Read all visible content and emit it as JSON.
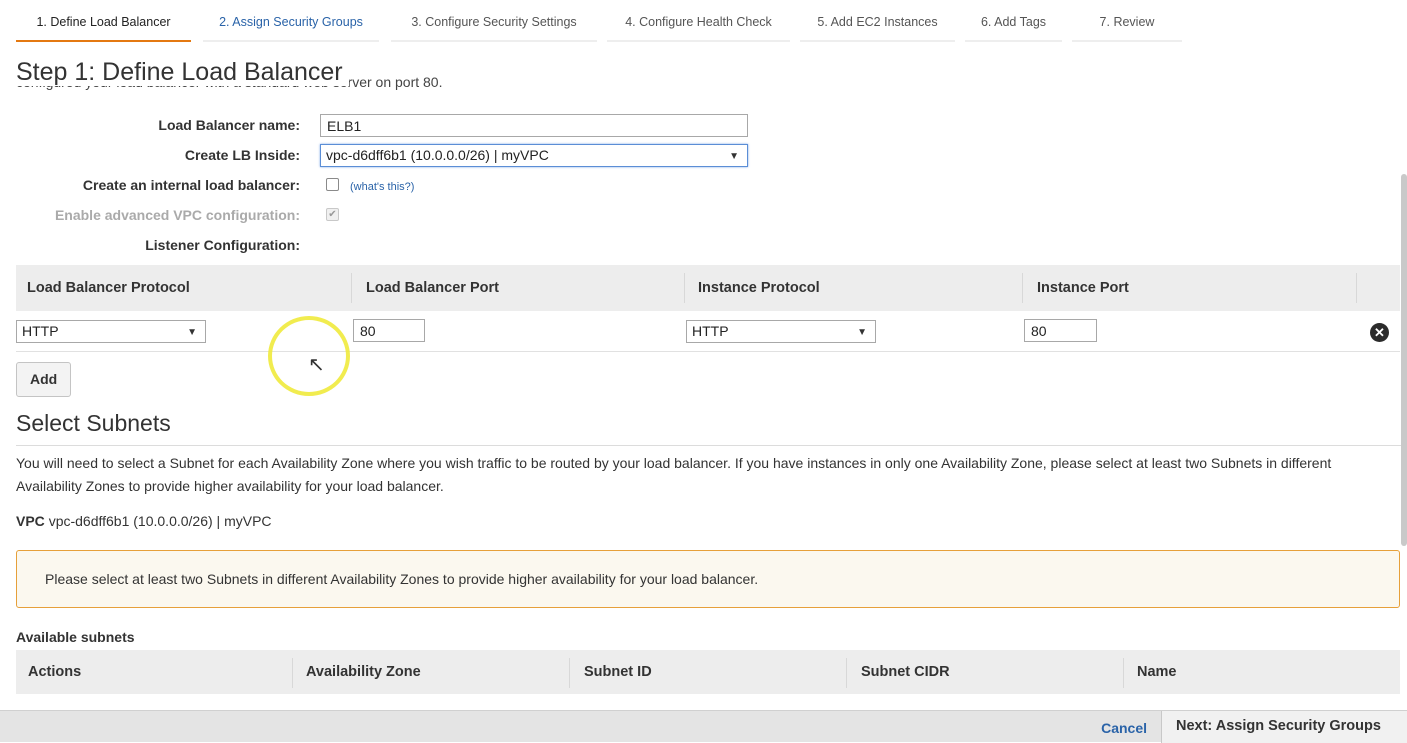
{
  "wizard": {
    "steps": [
      {
        "label": "1. Define Load Balancer",
        "state": "active"
      },
      {
        "label": "2. Assign Security Groups",
        "state": "link"
      },
      {
        "label": "3. Configure Security Settings",
        "state": "normal"
      },
      {
        "label": "4. Configure Health Check",
        "state": "normal"
      },
      {
        "label": "5. Add EC2 Instances",
        "state": "normal"
      },
      {
        "label": "6. Add Tags",
        "state": "normal"
      },
      {
        "label": "7. Review",
        "state": "normal"
      }
    ]
  },
  "page": {
    "title": "Step 1: Define Load Balancer",
    "cut_off_text": "configured your load balancer with a standard web server on port 80."
  },
  "form": {
    "lb_name_label": "Load Balancer name:",
    "lb_name_value": "ELB1",
    "create_inside_label": "Create LB Inside:",
    "create_inside_value": "vpc-d6dff6b1 (10.0.0.0/26) | myVPC",
    "internal_label": "Create an internal load balancer:",
    "internal_checked": false,
    "whats_this": "(what's this?)",
    "advanced_vpc_label": "Enable advanced VPC configuration:",
    "advanced_vpc_checked": true,
    "listener_label": "Listener Configuration:"
  },
  "listeners": {
    "headers": [
      "Load Balancer Protocol",
      "Load Balancer Port",
      "Instance Protocol",
      "Instance Port"
    ],
    "rows": [
      {
        "lb_protocol": "HTTP",
        "lb_port": "80",
        "instance_protocol": "HTTP",
        "instance_port": "80"
      }
    ],
    "add_label": "Add"
  },
  "subnets": {
    "title": "Select Subnets",
    "description": "You will need to select a Subnet for each Availability Zone where you wish traffic to be routed by your load balancer. If you have instances in only one Availability Zone, please select at least two Subnets in different Availability Zones to provide higher availability for your load balancer.",
    "vpc_label": "VPC",
    "vpc_value": "vpc-d6dff6b1 (10.0.0.0/26) | myVPC",
    "warning": "Please select at least two Subnets in different Availability Zones to provide higher availability for your load balancer.",
    "available_label": "Available subnets",
    "columns": [
      "Actions",
      "Availability Zone",
      "Subnet ID",
      "Subnet CIDR",
      "Name"
    ]
  },
  "footer": {
    "cancel_label": "Cancel",
    "next_label": "Next: Assign Security Groups"
  },
  "icons": {
    "remove": "close-circle-icon",
    "dropdown": "chevron-down-icon",
    "cursor": "mouse-pointer-icon",
    "check": "checkmark-icon"
  },
  "colors": {
    "active_tab": "#e47911",
    "link": "#2a63a8",
    "warning_border": "#e6a03a",
    "warning_bg": "#fbf8ef"
  }
}
